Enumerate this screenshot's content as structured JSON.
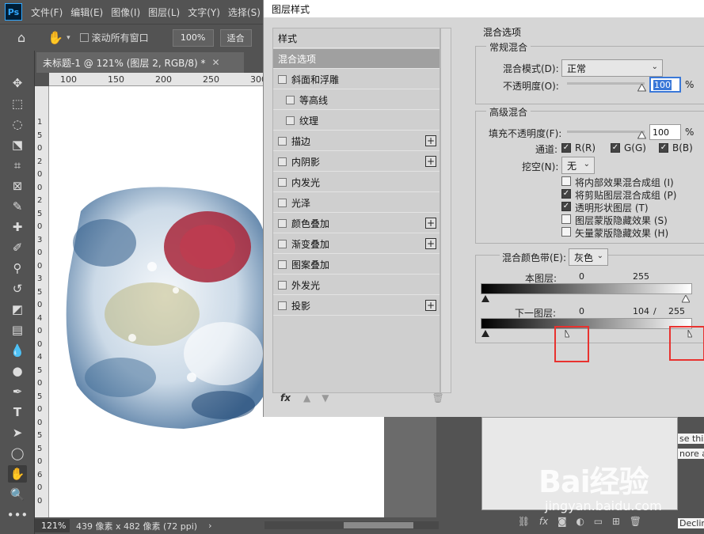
{
  "ps": {
    "logo": "Ps",
    "menu": [
      "文件(F)",
      "编辑(E)",
      "图像(I)",
      "图层(L)",
      "文字(Y)",
      "选择(S)"
    ],
    "options": {
      "scroll_all_label": "滚动所有窗口",
      "zoom_value": "100%",
      "fit_label": "适合"
    },
    "doc_tab": "未标题-1 @ 121% (图层 2, RGB/8) *",
    "ruler_top": [
      "100",
      "150",
      "200",
      "250",
      "300"
    ],
    "ruler_left": [
      "1",
      "5",
      "0",
      "2",
      "0",
      "0",
      "2",
      "5",
      "0",
      "3",
      "0",
      "0",
      "3",
      "5",
      "0",
      "4",
      "0",
      "0",
      "4",
      "5",
      "0",
      "5",
      "0",
      "0",
      "5",
      "5",
      "0",
      "6",
      "0",
      "0"
    ],
    "status": {
      "zoom": "121%",
      "dims": "439 像素 x 482 像素 (72 ppi)"
    },
    "side_text": [
      "se this",
      "nore a",
      "Declin"
    ],
    "watermark": {
      "brand": "Bai经验",
      "url": "jingyan.baidu.com"
    }
  },
  "dialog": {
    "title": "图层样式",
    "styles": [
      {
        "label": "样式",
        "checkbox": false,
        "plus": false,
        "selected": false,
        "indent": false
      },
      {
        "label": "混合选项",
        "checkbox": false,
        "plus": false,
        "selected": true,
        "indent": false
      },
      {
        "label": "斜面和浮雕",
        "checkbox": true,
        "plus": false,
        "selected": false,
        "indent": false
      },
      {
        "label": "等高线",
        "checkbox": true,
        "plus": false,
        "selected": false,
        "indent": true
      },
      {
        "label": "纹理",
        "checkbox": true,
        "plus": false,
        "selected": false,
        "indent": true
      },
      {
        "label": "描边",
        "checkbox": true,
        "plus": true,
        "selected": false,
        "indent": false
      },
      {
        "label": "内阴影",
        "checkbox": true,
        "plus": true,
        "selected": false,
        "indent": false
      },
      {
        "label": "内发光",
        "checkbox": true,
        "plus": false,
        "selected": false,
        "indent": false
      },
      {
        "label": "光泽",
        "checkbox": true,
        "plus": false,
        "selected": false,
        "indent": false
      },
      {
        "label": "颜色叠加",
        "checkbox": true,
        "plus": true,
        "selected": false,
        "indent": false
      },
      {
        "label": "渐变叠加",
        "checkbox": true,
        "plus": true,
        "selected": false,
        "indent": false
      },
      {
        "label": "图案叠加",
        "checkbox": true,
        "plus": false,
        "selected": false,
        "indent": false
      },
      {
        "label": "外发光",
        "checkbox": true,
        "plus": false,
        "selected": false,
        "indent": false
      },
      {
        "label": "投影",
        "checkbox": true,
        "plus": true,
        "selected": false,
        "indent": false
      }
    ],
    "footer": {
      "fx": "fx"
    },
    "blend_options": {
      "section_title": "混合选项",
      "general": {
        "title": "常规混合",
        "mode_label": "混合模式(D):",
        "mode_value": "正常",
        "opacity_label": "不透明度(O):",
        "opacity_value": "100",
        "percent": "%"
      },
      "advanced": {
        "title": "高级混合",
        "fill_label": "填充不透明度(F):",
        "fill_value": "100",
        "percent": "%",
        "channels_label": "通道:",
        "channels": [
          "R(R)",
          "G(G)",
          "B(B)"
        ],
        "knockout_label": "挖空(N):",
        "knockout_value": "无",
        "options": [
          {
            "label": "将内部效果混合成组 (I)",
            "checked": false
          },
          {
            "label": "将剪贴图层混合成组 (P)",
            "checked": true
          },
          {
            "label": "透明形状图层 (T)",
            "checked": true
          },
          {
            "label": "图层蒙版隐藏效果 (S)",
            "checked": false
          },
          {
            "label": "矢量蒙版隐藏效果 (H)",
            "checked": false
          }
        ]
      },
      "blend_if": {
        "label": "混合颜色带(E):",
        "value": "灰色",
        "this_layer_label": "本图层:",
        "this_layer_low": "0",
        "this_layer_high": "255",
        "underlying_label": "下一图层:",
        "underlying_low": "0",
        "underlying_split": "104",
        "slash": "/",
        "underlying_high": "255"
      }
    }
  }
}
